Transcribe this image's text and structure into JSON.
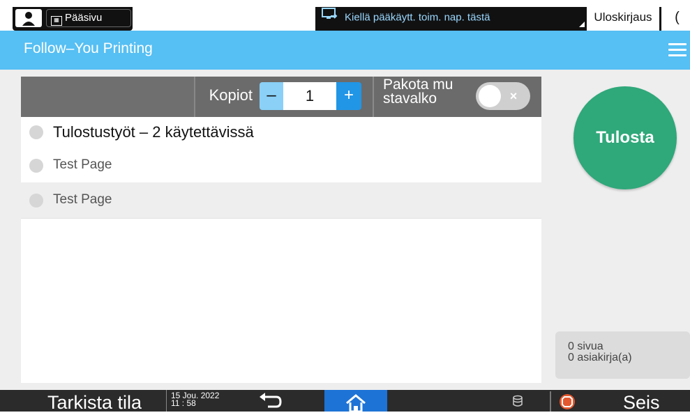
{
  "topbar": {
    "home_label": "Pääsivu",
    "admin_notice": "Kiellä pääkäytt. toim. nap. tästä",
    "logout_label": "Uloskirjaus",
    "moon_glyph": "("
  },
  "titlebar": {
    "title": "Follow–You Printing"
  },
  "toolbar": {
    "copies_label": "Kopiot",
    "minus_label": "–",
    "copies_value": "1",
    "plus_label": "+",
    "force_bw_label": "Pakota mu stavalko",
    "toggle_state": "off",
    "toggle_glyph": "×"
  },
  "list": {
    "group_label": "Tulostustyöt – 2 käytettävissä",
    "items": [
      {
        "label": "Test Page"
      },
      {
        "label": "Test Page"
      }
    ]
  },
  "side": {
    "print_label": "Tulosta",
    "pages": "0 sivua",
    "documents": "0 asiakirja(a)"
  },
  "bottombar": {
    "check_status": "Tarkista tila",
    "date": "15 Jou. 2022",
    "time": "11 : 58",
    "stop_label": "Seis"
  },
  "colors": {
    "title_bar": "#56bff3",
    "print_button": "#2fa87a",
    "plus_button": "#2196e6",
    "minus_button": "#8ad0f7",
    "home_button": "#1d73d6",
    "stop_icon": "#e3582f"
  },
  "icons": [
    "user-icon",
    "keyboard-icon",
    "monitor-icon",
    "hamburger-menu-icon",
    "back-arrow-icon",
    "home-icon",
    "database-icon",
    "stop-icon"
  ]
}
